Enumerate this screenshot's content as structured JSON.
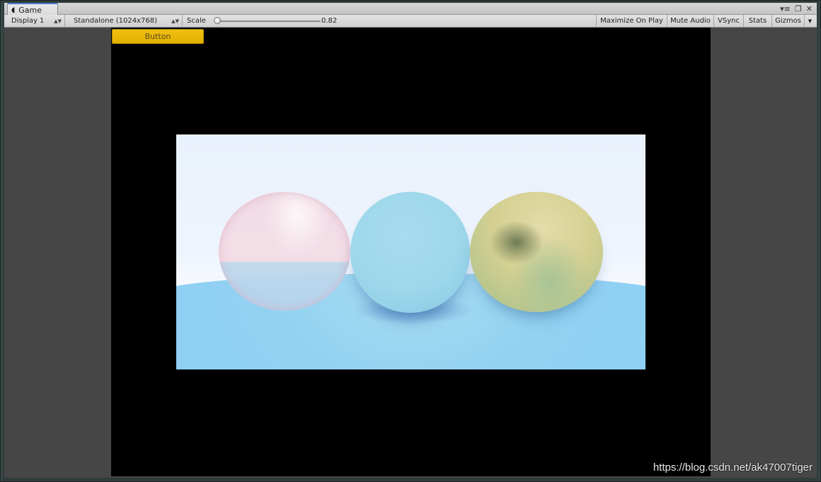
{
  "tab": {
    "title": "Game",
    "icon": "game-icon"
  },
  "window_controls": {
    "menu_glyph": "▾≡",
    "maximize_glyph": "❐",
    "close_glyph": "✕"
  },
  "toolbar": {
    "display": "Display 1",
    "resolution": "Standalone (1024x768)",
    "scale_label": "Scale",
    "scale_value": "0.82",
    "scale_fraction": 0.0,
    "maximize_on_play": "Maximize On Play",
    "mute_audio": "Mute Audio",
    "vsync": "VSync",
    "stats": "Stats",
    "gizmos": "Gizmos"
  },
  "game": {
    "button_label": "Button"
  },
  "watermark": "https://blog.csdn.net/ak47007tiger",
  "colors": {
    "button": "#e6b300",
    "game_background": "#000000",
    "tab_accent": "#4f80c8"
  }
}
